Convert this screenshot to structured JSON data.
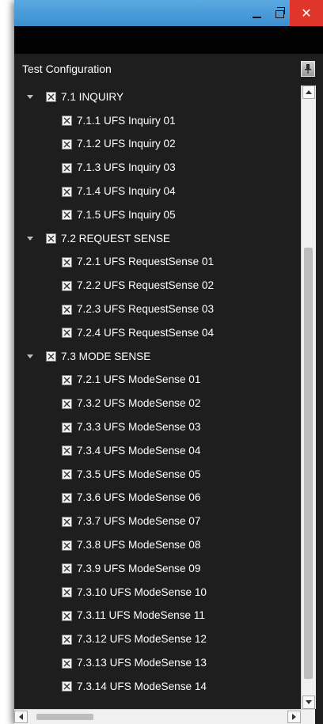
{
  "window": {
    "minimize_icon": "minimize-icon",
    "maximize_icon": "restore-icon",
    "close_icon": "close-icon",
    "close_glyph": "✕",
    "accent": "#3b8fd0",
    "close_color": "#e0352a"
  },
  "panel": {
    "title": "Test Configuration",
    "pin_icon": "pin-icon"
  },
  "tree": {
    "groups": [
      {
        "label": "7.1 INQUIRY",
        "expanded": true,
        "children": [
          "7.1.1 UFS Inquiry 01",
          "7.1.2 UFS Inquiry 02",
          "7.1.3 UFS Inquiry 03",
          "7.1.4 UFS Inquiry 04",
          "7.1.5 UFS Inquiry 05"
        ]
      },
      {
        "label": "7.2 REQUEST SENSE",
        "expanded": true,
        "children": [
          "7.2.1 UFS RequestSense 01",
          "7.2.2 UFS RequestSense 02",
          "7.2.3 UFS RequestSense 03",
          "7.2.4 UFS RequestSense 04"
        ]
      },
      {
        "label": "7.3 MODE SENSE",
        "expanded": true,
        "children": [
          "7.2.1 UFS ModeSense 01",
          "7.3.2 UFS ModeSense 02",
          "7.3.3 UFS ModeSense 03",
          "7.3.4 UFS ModeSense 04",
          "7.3.5 UFS ModeSense 05",
          "7.3.6 UFS ModeSense 06",
          "7.3.7 UFS ModeSense 07",
          "7.3.8 UFS ModeSense 08",
          "7.3.9 UFS ModeSense 09",
          "7.3.10 UFS ModeSense 10",
          "7.3.11 UFS ModeSense 11",
          "7.3.12 UFS ModeSense 12",
          "7.3.13 UFS ModeSense 13",
          "7.3.14 UFS ModeSense 14"
        ]
      }
    ]
  }
}
